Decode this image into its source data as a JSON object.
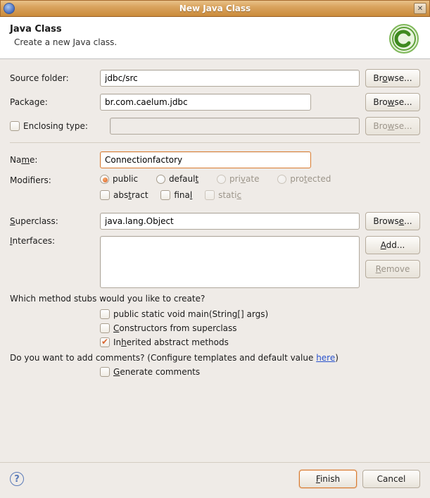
{
  "window": {
    "title": "New Java Class",
    "close_tooltip": "Close"
  },
  "banner": {
    "heading": "Java Class",
    "subheading": "Create a new Java class."
  },
  "labels": {
    "source_folder": "Source folder:",
    "package": "Package:",
    "enclosing_type": "Enclosing type:",
    "name": "Name:",
    "modifiers": "Modifiers:",
    "superclass": "Superclass:",
    "interfaces": "Interfaces:"
  },
  "buttons": {
    "browse": "Browse...",
    "add": "Add...",
    "remove": "Remove",
    "finish": "Finish",
    "cancel": "Cancel"
  },
  "fields": {
    "source_folder": "jdbc/src",
    "package": "br.com.caelum.jdbc",
    "enclosing_type": "",
    "name": "Connectionfactory",
    "superclass": "java.lang.Object",
    "interfaces": ""
  },
  "modifiers": {
    "access": {
      "public": "public",
      "default": "default",
      "private": "private",
      "protected": "protected",
      "selected": "public"
    },
    "flags": {
      "abstract": "abstract",
      "final": "final",
      "static": "static"
    }
  },
  "stubs": {
    "question": "Which method stubs would you like to create?",
    "main": "public static void main(String[] args)",
    "constructors": "Constructors from superclass",
    "inherited": "Inherited abstract methods",
    "inherited_checked": true
  },
  "comments": {
    "question_prefix": "Do you want to add comments? (Configure templates and default value ",
    "link": "here",
    "question_suffix": ")",
    "generate": "Generate comments"
  }
}
